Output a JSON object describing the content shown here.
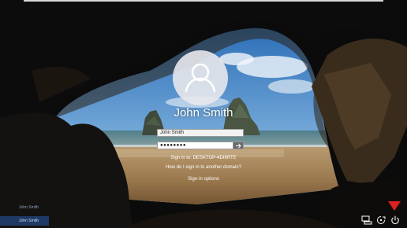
{
  "login": {
    "username": "John Smith",
    "username_field_value": "John Smith",
    "password_masked": "●●●●●●●●",
    "sign_in_to": "Sign in to: DESKTOP-4DI6RTE",
    "other_domain_link": "How do I sign in to another domain?",
    "sign_in_options_link": "Sign-in options"
  },
  "user_list": [
    {
      "name": "John Smith",
      "selected": false
    },
    {
      "name": "John Smith",
      "selected": true
    }
  ],
  "taskbar_icons": [
    "network-icon",
    "ease-of-access-icon",
    "power-icon"
  ],
  "colors": {
    "accent": "#1e3a66",
    "arrow_indicator": "#e02020",
    "text": "#ffffff"
  }
}
